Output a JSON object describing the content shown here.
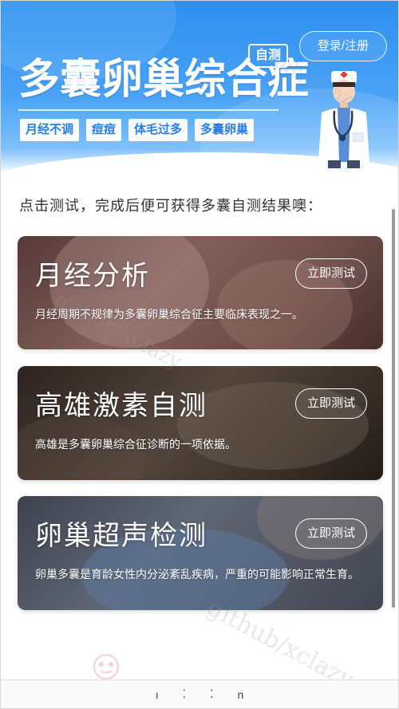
{
  "header": {
    "login_label": "登录/注册",
    "title": "多囊卵巢综合症",
    "self_test_tag": "自测",
    "tags": [
      "月经不调",
      "痘痘",
      "体毛过多",
      "多囊卵巢"
    ]
  },
  "intro": "点击测试，完成后便可获得多囊自测结果噢：",
  "cards": [
    {
      "title": "月经分析",
      "button": "立即测试",
      "desc": "月经周期不规律为多囊卵巢综合征主要临床表现之一。"
    },
    {
      "title": "高雄激素自测",
      "button": "立即测试",
      "desc": "高雄是多囊卵巢综合征诊断的一项依据。"
    },
    {
      "title": "卵巢超声检测",
      "button": "立即测试",
      "desc": "卵巢多囊是育龄女性内分泌紊乱疾病，严重的可能影响正常生育。"
    }
  ],
  "watermarks": [
    "github/xclazy",
    "github/xclazy",
    "github/xclazy"
  ],
  "bottom_bar": {
    "items": [
      "ı",
      "⁚",
      "⁚",
      "n"
    ]
  }
}
